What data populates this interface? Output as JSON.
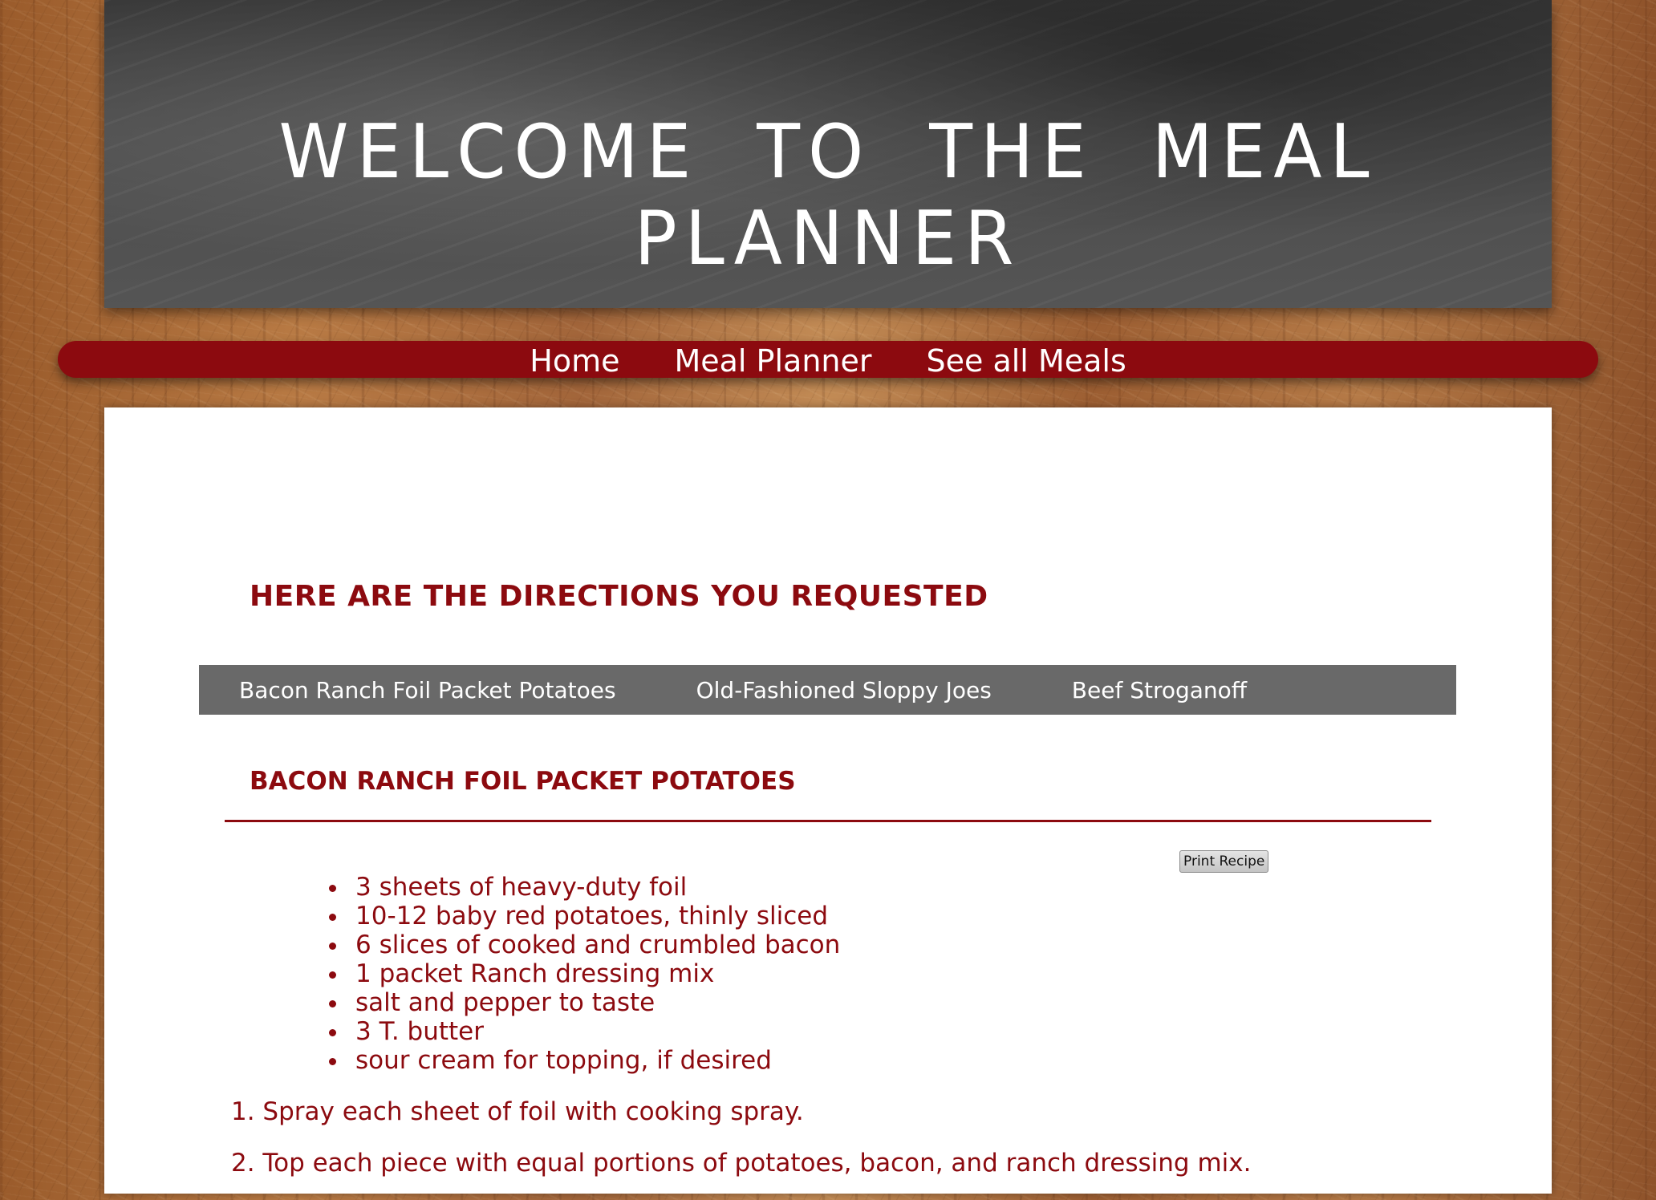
{
  "header": {
    "title": "WELCOME TO THE MEAL PLANNER"
  },
  "nav": {
    "items": [
      "Home",
      "Meal Planner",
      "See all Meals"
    ]
  },
  "main": {
    "heading": "HERE ARE THE DIRECTIONS YOU REQUESTED",
    "tabs": [
      "Bacon Ranch Foil Packet Potatoes",
      "Old-Fashioned Sloppy Joes",
      "Beef Stroganoff"
    ],
    "recipe": {
      "title": "BACON RANCH FOIL PACKET POTATOES",
      "print_label": "Print Recipe",
      "ingredients": [
        "3 sheets of heavy-duty foil",
        "10-12 baby red potatoes, thinly sliced",
        "6 slices of cooked and crumbled bacon",
        "1 packet Ranch dressing mix",
        "salt and pepper to taste",
        "3 T. butter",
        "sour cream for topping, if desired"
      ],
      "steps": [
        "1. Spray each sheet of foil with cooking spray.",
        "2. Top each piece with equal portions of potatoes, bacon, and ranch dressing mix."
      ]
    }
  },
  "colors": {
    "accent": "#8c0a0f",
    "tab_bar": "#696969",
    "chalkboard": "#4b4b4b"
  }
}
